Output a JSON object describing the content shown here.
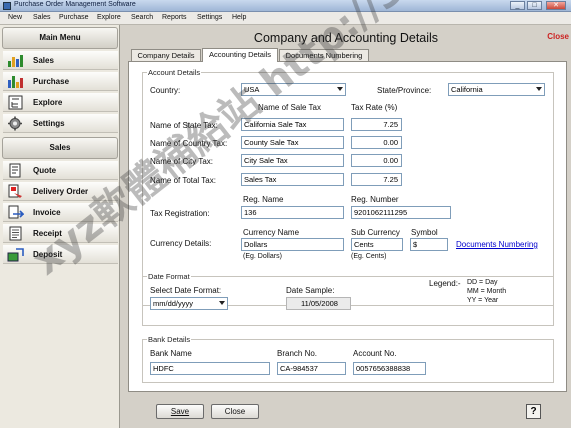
{
  "window": {
    "title": "Purchase Order Management Software",
    "min": "_",
    "max": "□",
    "close": "✕"
  },
  "menu": [
    "New",
    "Sales",
    "Purchase",
    "Explore",
    "Search",
    "Reports",
    "Settings",
    "Help"
  ],
  "sidebar": {
    "main_menu": "Main Menu",
    "main_items": [
      {
        "label": "Sales",
        "icon": "chart-icon"
      },
      {
        "label": "Purchase",
        "icon": "chart-icon"
      },
      {
        "label": "Explore",
        "icon": "tree-icon"
      },
      {
        "label": "Settings",
        "icon": "gear-icon"
      }
    ],
    "sales_header": "Sales",
    "sales_items": [
      {
        "label": "Quote",
        "icon": "document-icon"
      },
      {
        "label": "Delivery Order",
        "icon": "delivery-icon"
      },
      {
        "label": "Invoice",
        "icon": "invoice-icon"
      },
      {
        "label": "Receipt",
        "icon": "receipt-icon"
      },
      {
        "label": "Deposit",
        "icon": "deposit-icon"
      }
    ]
  },
  "main": {
    "title": "Company and Accounting Details",
    "close_label": "Close",
    "tabs": [
      "Company Details",
      "Accounting Details",
      "Documents Numbering"
    ],
    "active_tab": 1
  },
  "account": {
    "group": "Account Details",
    "country_label": "Country:",
    "country": "USA",
    "state_label": "State/Province:",
    "state": "California",
    "col_name": "Name of Sale Tax",
    "col_rate": "Tax Rate (%)",
    "rows": [
      {
        "label": "Name of State Tax:",
        "name": "California Sale Tax",
        "rate": "7.25"
      },
      {
        "label": "Name of Country Tax:",
        "name": "County Sale Tax",
        "rate": "0.00"
      },
      {
        "label": "Name of City Tax:",
        "name": "City Sale Tax",
        "rate": "0.00"
      },
      {
        "label": "Name of Total Tax:",
        "name": "Sales Tax",
        "rate": "7.25"
      }
    ],
    "reg_name_hdr": "Reg. Name",
    "reg_number_hdr": "Reg. Number",
    "reg_label": "Tax Registration:",
    "reg_name": "136",
    "reg_number": "9201062111295",
    "currency_label": "Currency Details:",
    "currency_name_hdr": "Currency Name",
    "currency_name": "Dollars",
    "currency_example": "(Eg. Dollars)",
    "sub_currency_hdr": "Sub Currency",
    "sub_currency": "Cents",
    "sub_example": "(Eg. Cents)",
    "symbol_hdr": "Symbol",
    "symbol": "$",
    "doc_numbering_link": "Documents Numbering"
  },
  "date": {
    "group": "Date Format",
    "select_label": "Select Date Format:",
    "format": "mm/dd/yyyy",
    "sample_label": "Date Sample:",
    "sample": "11/05/2008",
    "legend_label": "Legend:-",
    "legend_lines": [
      "DD = Day",
      "MM = Month",
      "YY = Year"
    ]
  },
  "bank": {
    "group": "Bank Details",
    "name_hdr": "Bank Name",
    "name": "HDFC",
    "branch_hdr": "Branch No.",
    "branch": "CA-984537",
    "account_hdr": "Account No.",
    "account": "0057656388838"
  },
  "buttons": {
    "save": "Save",
    "close": "Close",
    "help": "?"
  },
  "watermark": "xyz軟體補給站 http://31.to"
}
